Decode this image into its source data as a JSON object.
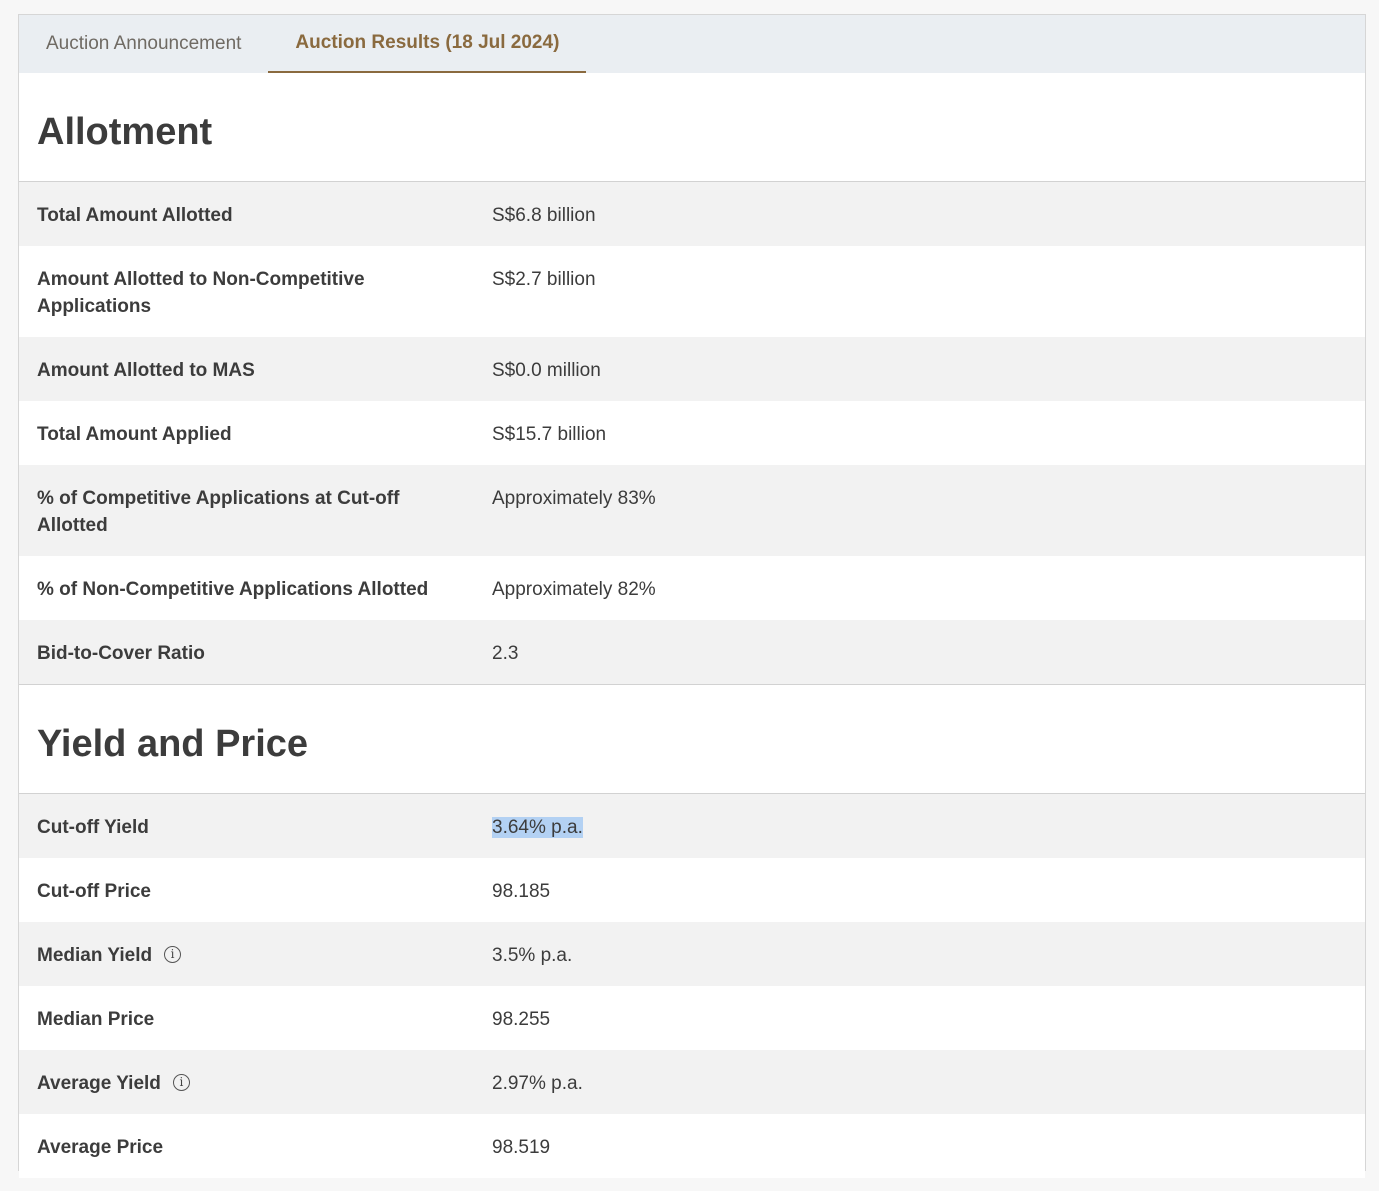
{
  "tabs": [
    {
      "label": "Auction Announcement",
      "active": false
    },
    {
      "label": "Auction Results (18 Jul 2024)",
      "active": true
    }
  ],
  "allotment": {
    "title": "Allotment",
    "rows": [
      {
        "label": "Total Amount Allotted",
        "value": "S$6.8 billion"
      },
      {
        "label": "Amount Allotted to Non-Competitive Applications",
        "value": "S$2.7 billion"
      },
      {
        "label": "Amount Allotted to MAS",
        "value": "S$0.0 million"
      },
      {
        "label": "Total Amount Applied",
        "value": "S$15.7 billion"
      },
      {
        "label": "% of Competitive Applications at Cut-off Allotted",
        "value": "Approximately 83%"
      },
      {
        "label": "% of Non-Competitive Applications Allotted",
        "value": "Approximately 82%"
      },
      {
        "label": "Bid-to-Cover Ratio",
        "value": "2.3"
      }
    ]
  },
  "yield_price": {
    "title": "Yield and Price",
    "rows": [
      {
        "label": "Cut-off Yield",
        "value": "3.64% p.a."
      },
      {
        "label": "Cut-off Price",
        "value": "98.185"
      },
      {
        "label": "Median Yield",
        "value": "3.5% p.a."
      },
      {
        "label": "Median Price",
        "value": "98.255"
      },
      {
        "label": "Average Yield",
        "value": "2.97% p.a."
      },
      {
        "label": "Average Price",
        "value": "98.519"
      }
    ]
  },
  "icons": {
    "info_glyph": "i",
    "info_icon_name": "info-icon"
  },
  "colors": {
    "accent": "#8a6a3f",
    "tabbar_bg": "#eaeef2",
    "row_alt_bg": "#f2f2f2",
    "selection_highlight": "#b3d1f3"
  }
}
